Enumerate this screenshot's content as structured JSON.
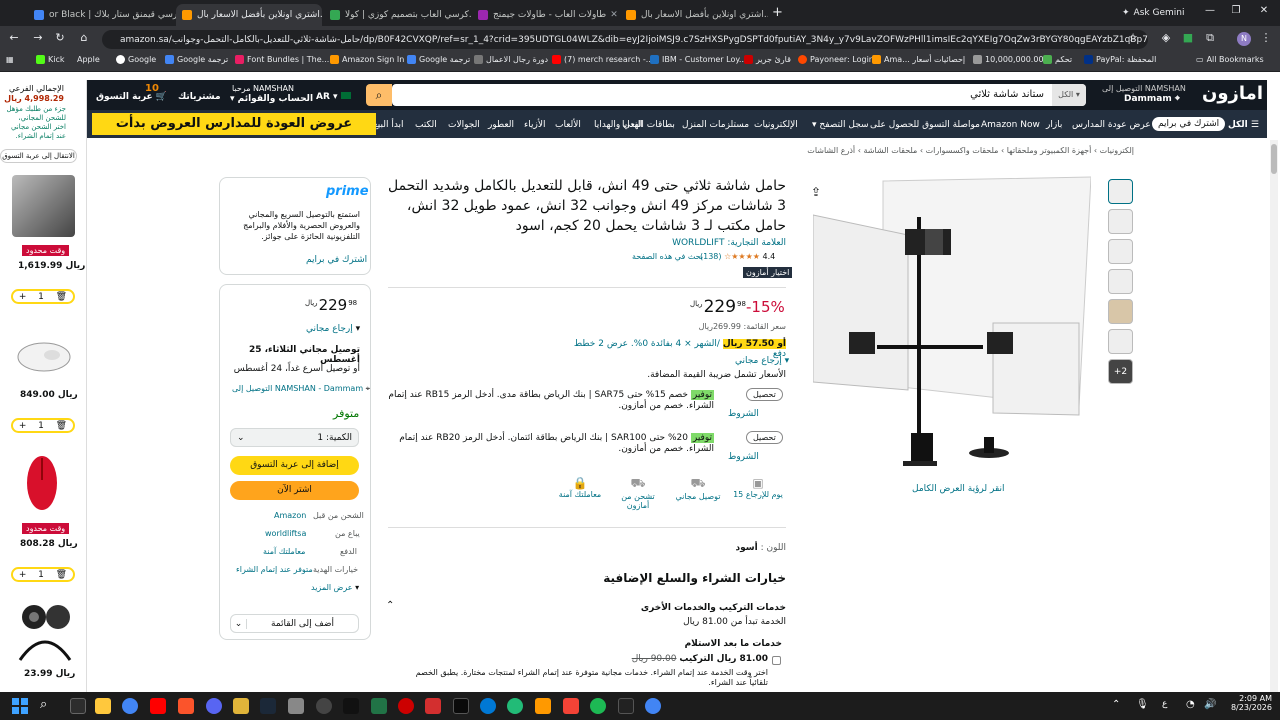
{
  "browser": {
    "tabs": [
      {
        "label": "or Black | كرسي قيمنق ستار بلاك",
        "color": "#4285f4"
      },
      {
        "label": "اشتري اونلاين بأفضل الاسعار بال...",
        "color": "#ff9900"
      },
      {
        "label": "كرسي العاب بتصميم كوزي | كولا...",
        "color": "#34a853"
      },
      {
        "label": "طاولات العاب - طاولات جيمنج",
        "color": "#9c27b0"
      },
      {
        "label": "اشتري اونلاين بأفضل الاسعار بال...",
        "color": "#ff9900"
      }
    ],
    "new_tab": "+",
    "ask_gemini": "Ask Gemini",
    "url": "amazon.sa/حامل-شاشة-ثلاثي-للتعديل-بالكامل-التحمل-وجوانب/dp/B0F42CVXQP/ref=sr_1_4?crid=395UDTGL04WLZ&dib=eyJ2IjoiMSJ9.c7SzHXSPygDSPTd0fputiAY_3N4y_y7v9LavZOFWzPHll1imsIEc2qYXEIg7OqZw3rBYGY80qgEAYzbZ1qBp7UsajxnfHH-qiLl8UjmQYzKzHg8VK...",
    "bookmarks": [
      "Kick",
      "Apple",
      "Google",
      "Google ترجمة",
      "Font Bundles | The...",
      "Amazon Sign In",
      "Google ترجمة",
      "دورة رجال الاعمال",
      "(7) merch research -...",
      "IBM - Customer Loy...",
      "قارئ جرير",
      "Payoneer: Login",
      "Ama... إحصائيات أسعار",
      "10,000,000.00",
      "تحكم",
      "PayPal: المحفظة",
      "All Bookmarks"
    ]
  },
  "amazon": {
    "logo": "امازون",
    "deliver_to": "التوصيل إلى NAMSHAN",
    "deliver_city": "Dammam",
    "search_category": "الكل",
    "search_query": "ستاند شاشة ثلاثي",
    "language": "AR",
    "account_greeting": "مرحبا NAMSHAN",
    "account_label": "الحساب والقوائم",
    "orders": "مشترياتك",
    "cart_count": "10",
    "cart_label": "عربة التسوق",
    "nav": [
      "الكل",
      "اشترك في برايم",
      "عرض عودة المدارس",
      "بازار",
      "Amazon Now",
      "مواصلة التسوق للحصول على",
      "سجل التصفح",
      "الإلكترونيات",
      "مستلزمات المنزل",
      "بطاقات الهدايا",
      "النعي والهدايا",
      "الألعاب",
      "الأزياء",
      "العطور",
      "الجوالات",
      "الكتب",
      "ابدأ البيع"
    ],
    "banner": "عروض العودة للمدارس العروض بدأت"
  },
  "cart_panel": {
    "subtotal_label": "الإجمالي الفرعي",
    "subtotal": "4,998.29 ريال",
    "note": "جزء من طلبك مؤهل للشحن المجاني، اختر الشحن مجاني عند إتمام الشراء.",
    "go_to_cart": "الانتقال إلى عربة التسوق",
    "items": [
      {
        "badge": "وقت محدود",
        "price": "1,619.99 ريال",
        "qty": "1"
      },
      {
        "badge": "",
        "price": "849.00 ريال",
        "qty": "1"
      },
      {
        "badge": "وقت محدود",
        "price": "808.28 ريال",
        "qty": "1"
      },
      {
        "badge": "",
        "price": "23.99 ريال",
        "qty": ""
      }
    ]
  },
  "breadcrumb": "إلكترونيات › أجهزة الكمبيوتر وملحقاتها › ملحقات واكسسوارات › ملحقات الشاشة › أذرع الشاشات",
  "product": {
    "title": "حامل شاشة ثلاثي حتى 49 انش، قابل للتعديل بالكامل وشديد التحمل 3 شاشات مركز 49 انش وجوانب 32 انش، عمود طويل 32 انش، حامل مكتب لـ 3 شاشات يحمل 20 كجم، اسود",
    "brand": "العلامة التجارية: WORLDLIFT",
    "rating": "4.4",
    "reviews": "(138)",
    "search_page": "بحث في هذه الصفحة",
    "choice": "اختيار أمازون",
    "discount": "-15%",
    "price_whole": "229",
    "price_frac": "98",
    "currency": "ريال",
    "list_price": "سعر القائمة: 269.99ريال",
    "installments_amount": "أو 57.50 ريال",
    "installments_text": "/الشهر × 4 بفائدة 0%. عرض 2 خطط دفع",
    "free_returns": "إرجاع مجاني",
    "vat_note": "الأسعار تشمل ضريبة القيمة المضافة.",
    "offers": [
      {
        "tag": "توفير",
        "text": "خصم 15% حتى SAR75 | بنك الرياض بطاقة مدى. أدخل الرمز RB15 عند إتمام الشراء. خصم من أمازون.",
        "terms": "الشروط",
        "btn": "تحصيل"
      },
      {
        "tag": "توفير",
        "text": "20% حتى SAR100 | بنك الرياض بطاقة ائتمان. أدخل الرمز RB20 عند إتمام الشراء. خصم من أمازون.",
        "terms": "الشروط",
        "btn": "تحصيل"
      }
    ],
    "features": [
      "15 يوم للإرجاع",
      "توصيل مجاني",
      "تشحن من أمازون",
      "معاملتك آمنة"
    ],
    "color_label": "اللون :",
    "color_value": "أسود",
    "addons_heading": "خيارات الشراء والسلع الإضافية",
    "install_heading": "خدمات التركيب والخدمات الأخرى",
    "install_from": "الخدمة تبدأ من 81.00 ريال",
    "post_purchase": "خدمات ما بعد الاستلام",
    "install_item": "81.00 ريال التركيب",
    "install_old": "90.00 ريال",
    "install_desc": "اختر وقت الخدمة عند إتمام الشراء. خدمات مجانية متوفرة عند إتمام الشراء لمنتجات مختارة. يطبق الخصم تلقائياً عند الشراء.",
    "see_full": "انقر لرؤية العرض الكامل",
    "more_thumbs": "+2"
  },
  "prime_box": {
    "logo": "prime",
    "text": "استمتع بالتوصيل السريع والمجاني والعروض الحصرية والأفلام والبرامج التلفزيونية الحائزة على جوائز.",
    "link": "اشترك في برايم"
  },
  "buy_box": {
    "price": "229",
    "price_frac": "98",
    "currency": "ريال",
    "free_returns": "إرجاع مجاني",
    "delivery": "توصيل مجاني الثلاثاء، 25 أغسطس",
    "fastest": "أو توصيل أسرع غداً، 24 أغسطس",
    "deliver_to": "التوصيل إلى NAMSHAN - Dammam",
    "stock": "متوفر",
    "qty_label": "الكمية: 1",
    "add_to_cart": "إضافة إلى عربة التسوق",
    "buy_now": "اشتر الآن",
    "rows": [
      {
        "label": "الشحن من قبل",
        "value": "Amazon"
      },
      {
        "label": "يباع من",
        "value": "worldliftsa"
      },
      {
        "label": "الدفع",
        "value": "معاملتك آمنة"
      },
      {
        "label": "خيارات الهدية",
        "value": "متوفر عند إتمام الشراء"
      }
    ],
    "see_more": "عرض المزيد",
    "add_to_list": "أضف إلى القائمة"
  },
  "taskbar": {
    "time": "2:09 AM",
    "date": "8/23/2026",
    "search_icon": "search-icon"
  }
}
